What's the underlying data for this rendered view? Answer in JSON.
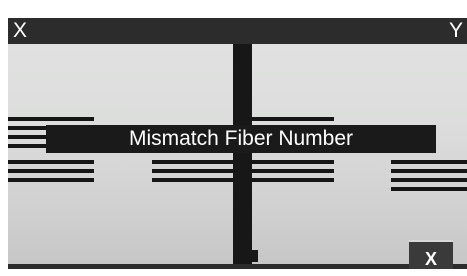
{
  "header": {
    "left_label": "X",
    "right_label": "Y"
  },
  "message": {
    "text": "Mismatch Fiber Number"
  },
  "footer": {
    "close_label": "X"
  },
  "colors": {
    "bars": "#2c2c2c",
    "banner": "#1a1a1a",
    "fiber": "#161616",
    "background": "#d6d7d6"
  }
}
